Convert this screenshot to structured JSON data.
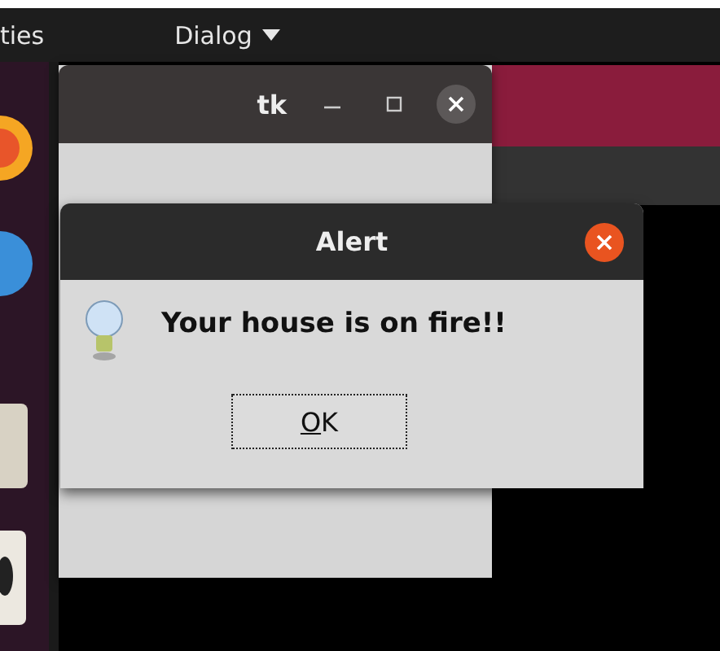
{
  "top_bar": {
    "activities": "ties",
    "menu": "Dialog"
  },
  "tk_window": {
    "title": "tk"
  },
  "alert": {
    "title": "Alert",
    "message": "Your house is on fire!!",
    "button": {
      "label": "OK",
      "focused": true
    }
  }
}
